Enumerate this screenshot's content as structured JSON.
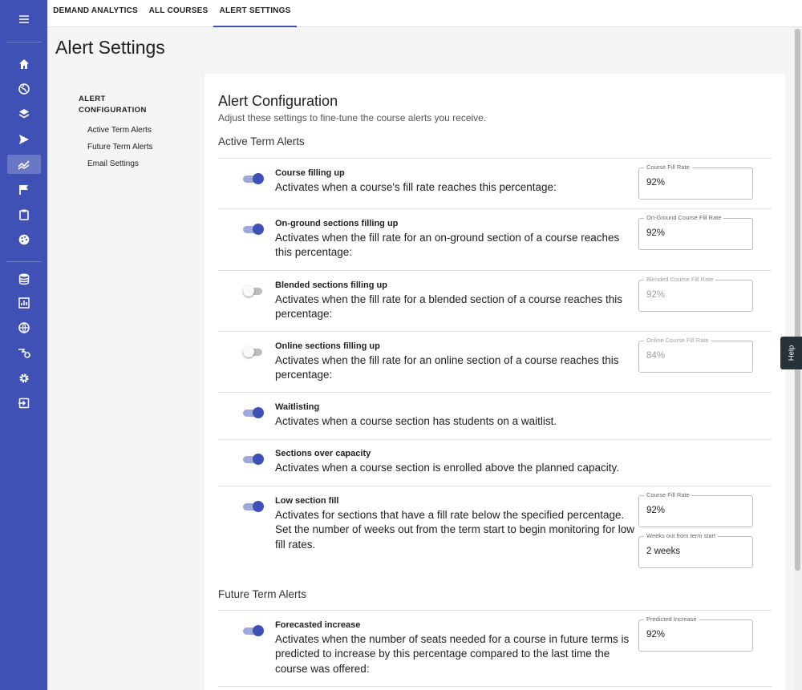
{
  "colors": {
    "primary": "#3f51b5",
    "rail_active": "rgba(255,255,255,0.22)",
    "toggle_on_track": "#9fa8da"
  },
  "rail": {
    "items": [
      {
        "icon": "menu-icon"
      },
      {
        "icon": "home-icon"
      },
      {
        "icon": "globe-icon"
      },
      {
        "icon": "layers-icon"
      },
      {
        "icon": "send-icon"
      },
      {
        "icon": "trend-icon"
      },
      {
        "icon": "flag-icon"
      },
      {
        "icon": "clipboard-icon"
      },
      {
        "icon": "palette-icon"
      },
      {
        "icon": "database-icon"
      },
      {
        "icon": "bar-chart-icon"
      },
      {
        "icon": "globe-alt-icon"
      },
      {
        "icon": "route-icon"
      },
      {
        "icon": "gear-icon"
      },
      {
        "icon": "logout-icon"
      }
    ],
    "active": "trend-icon"
  },
  "tabs": [
    "DEMAND ANALYTICS",
    "ALL COURSES",
    "ALERT SETTINGS"
  ],
  "active_tab": "ALERT SETTINGS",
  "page_title": "Alert Settings",
  "left_nav": {
    "heading": "ALERT CONFIGURATION",
    "items": [
      "Active Term Alerts",
      "Future Term Alerts",
      "Email Settings"
    ]
  },
  "card": {
    "title": "Alert Configuration",
    "subtitle": "Adjust these settings to fine-tune the course alerts you receive.",
    "active_section": "Active Term Alerts",
    "future_section": "Future Term Alerts"
  },
  "alerts": [
    {
      "name": "Course filling up",
      "enabled": true,
      "description": "Activates when a course's fill rate reaches this percentage:",
      "field_label": "Course Fill Rate",
      "field_value": "92%"
    },
    {
      "name": "On-ground sections filling up",
      "enabled": true,
      "description": "Activates when the fill rate for an on-ground section of a course reaches this percentage:",
      "field_label": "On-Ground Course Fill Rate",
      "field_value": "92%"
    },
    {
      "name": "Blended sections filling up",
      "enabled": false,
      "description": "Activates when the fill rate for a blended section of a course reaches this percentage:",
      "field_label": "Blended Course Fill Rate",
      "field_value": "92%"
    },
    {
      "name": "Online sections filling up",
      "enabled": false,
      "description": "Activates when the fill rate for an online section of a course reaches this percentage:",
      "field_label": "Online Course Fill Rate",
      "field_value": "84%"
    },
    {
      "name": "Waitlisting",
      "enabled": true,
      "description": "Activates when a course section has students on a waitlist."
    },
    {
      "name": "Sections over capacity",
      "enabled": true,
      "description": "Activates when a course section is enrolled above the planned capacity."
    },
    {
      "name": "Low section fill",
      "enabled": true,
      "description": "Activates for sections that have a fill rate below the specified percentage. Set the number of weeks out from the term start to begin monitoring for low fill rates.",
      "field_label": "Course Fill Rate",
      "field_value": "92%",
      "field2_label": "Weeks out from term start",
      "field2_value": "2 weeks"
    },
    {
      "name": "Forecasted increase",
      "enabled": true,
      "description": "Activates when the number of seats needed for a course in future terms is predicted to increase by this percentage compared to the last time the course was offered:",
      "field_label": "Predicted Increase",
      "field_value": "92%"
    }
  ],
  "help_label": "Help"
}
